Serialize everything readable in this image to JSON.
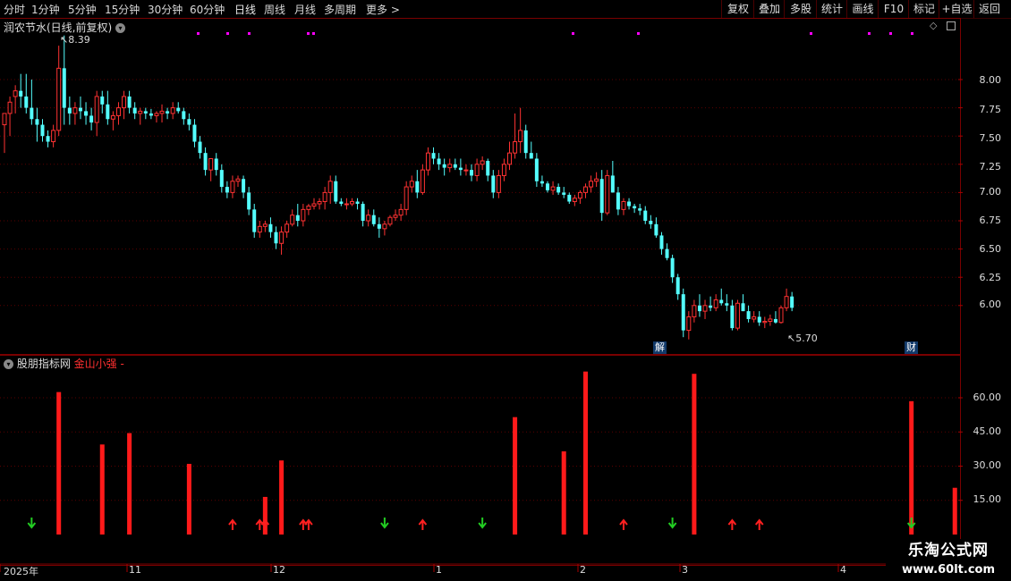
{
  "toolbar": {
    "periods": [
      "分时",
      "1分钟",
      "5分钟",
      "15分钟",
      "30分钟",
      "60分钟",
      "日线",
      "周线",
      "月线",
      "多周期",
      "更多"
    ],
    "more_arrow": ">",
    "right_buttons": [
      "复权",
      "叠加",
      "多股",
      "统计",
      "画线",
      "F10",
      "标记",
      "+自选",
      "返回"
    ]
  },
  "main_panel": {
    "title": "润农节水(日线,前复权)",
    "high_label": "8.39",
    "low_label": "5.70",
    "y_ticks": [
      "8.00",
      "7.75",
      "7.50",
      "7.25",
      "7.00",
      "6.75",
      "6.50",
      "6.25",
      "6.00"
    ],
    "markers": [
      "解",
      "财"
    ]
  },
  "indicator_panel": {
    "name": "股朋指标网",
    "indicator": "金山小强",
    "suffix": "-",
    "y_ticks": [
      "60.00",
      "45.00",
      "30.00",
      "15.00"
    ]
  },
  "x_axis": {
    "labels": [
      "2025年",
      "11",
      "12",
      "1",
      "2",
      "3",
      "4"
    ]
  },
  "watermark": {
    "line1": "乐淘公式网",
    "line2": "www.60lt.com"
  },
  "colors": {
    "up": "#ff3232",
    "down": "#54ffff",
    "bar": "#ff1a1a",
    "arrow_up": "#ff2020",
    "arrow_down": "#22cc22",
    "dots": "#ff00ff"
  },
  "chart_data": {
    "type": "candlestick",
    "price_axis": [
      5.7,
      8.39
    ],
    "candles": [
      [
        7.6,
        7.7,
        7.35,
        7.7
      ],
      [
        7.7,
        7.85,
        7.5,
        7.8
      ],
      [
        7.85,
        7.95,
        7.7,
        7.9
      ],
      [
        7.9,
        8.05,
        7.75,
        7.85
      ],
      [
        7.85,
        8.05,
        7.7,
        7.75
      ],
      [
        7.75,
        8.0,
        7.6,
        7.65
      ],
      [
        7.65,
        7.75,
        7.45,
        7.6
      ],
      [
        7.6,
        7.65,
        7.45,
        7.5
      ],
      [
        7.5,
        7.55,
        7.4,
        7.45
      ],
      [
        7.45,
        7.6,
        7.4,
        7.55
      ],
      [
        7.55,
        8.3,
        7.5,
        8.1
      ],
      [
        8.1,
        8.39,
        7.6,
        7.75
      ],
      [
        7.75,
        7.85,
        7.6,
        7.7
      ],
      [
        7.7,
        7.8,
        7.6,
        7.75
      ],
      [
        7.75,
        7.85,
        7.65,
        7.72
      ],
      [
        7.72,
        7.8,
        7.6,
        7.68
      ],
      [
        7.68,
        7.75,
        7.55,
        7.62
      ],
      [
        7.62,
        7.9,
        7.5,
        7.85
      ],
      [
        7.85,
        7.9,
        7.7,
        7.78
      ],
      [
        7.78,
        7.9,
        7.6,
        7.65
      ],
      [
        7.65,
        7.72,
        7.55,
        7.68
      ],
      [
        7.68,
        7.8,
        7.6,
        7.75
      ],
      [
        7.75,
        7.9,
        7.65,
        7.85
      ],
      [
        7.85,
        7.9,
        7.7,
        7.75
      ],
      [
        7.75,
        7.8,
        7.65,
        7.7
      ],
      [
        7.7,
        7.75,
        7.6,
        7.72
      ],
      [
        7.72,
        7.75,
        7.65,
        7.7
      ],
      [
        7.7,
        7.74,
        7.65,
        7.68
      ],
      [
        7.68,
        7.72,
        7.62,
        7.7
      ],
      [
        7.7,
        7.78,
        7.62,
        7.72
      ],
      [
        7.72,
        7.75,
        7.65,
        7.7
      ],
      [
        7.7,
        7.8,
        7.65,
        7.75
      ],
      [
        7.75,
        7.8,
        7.7,
        7.72
      ],
      [
        7.72,
        7.75,
        7.6,
        7.65
      ],
      [
        7.65,
        7.7,
        7.55,
        7.6
      ],
      [
        7.6,
        7.65,
        7.4,
        7.45
      ],
      [
        7.45,
        7.5,
        7.3,
        7.35
      ],
      [
        7.35,
        7.4,
        7.15,
        7.2
      ],
      [
        7.2,
        7.3,
        7.1,
        7.3
      ],
      [
        7.3,
        7.35,
        7.15,
        7.2
      ],
      [
        7.2,
        7.25,
        7.0,
        7.05
      ],
      [
        7.05,
        7.1,
        6.95,
        7.0
      ],
      [
        7.0,
        7.15,
        6.95,
        7.1
      ],
      [
        7.1,
        7.15,
        7.05,
        7.12
      ],
      [
        7.12,
        7.15,
        6.95,
        7.0
      ],
      [
        7.0,
        7.05,
        6.8,
        6.85
      ],
      [
        6.85,
        6.9,
        6.6,
        6.65
      ],
      [
        6.65,
        6.75,
        6.6,
        6.7
      ],
      [
        6.7,
        6.75,
        6.65,
        6.72
      ],
      [
        6.72,
        6.78,
        6.6,
        6.65
      ],
      [
        6.65,
        6.7,
        6.5,
        6.55
      ],
      [
        6.55,
        6.7,
        6.45,
        6.65
      ],
      [
        6.65,
        6.75,
        6.6,
        6.72
      ],
      [
        6.72,
        6.85,
        6.7,
        6.8
      ],
      [
        6.8,
        6.9,
        6.7,
        6.75
      ],
      [
        6.75,
        6.9,
        6.7,
        6.85
      ],
      [
        6.85,
        6.9,
        6.8,
        6.88
      ],
      [
        6.88,
        6.95,
        6.85,
        6.9
      ],
      [
        6.9,
        6.95,
        6.85,
        6.92
      ],
      [
        6.92,
        7.05,
        6.85,
        7.0
      ],
      [
        7.0,
        7.15,
        6.9,
        7.1
      ],
      [
        7.1,
        7.15,
        6.9,
        6.92
      ],
      [
        6.92,
        6.95,
        6.88,
        6.9
      ],
      [
        6.9,
        6.95,
        6.85,
        6.9
      ],
      [
        6.9,
        6.95,
        6.88,
        6.92
      ],
      [
        6.92,
        6.95,
        6.85,
        6.9
      ],
      [
        6.9,
        6.92,
        6.7,
        6.75
      ],
      [
        6.75,
        6.85,
        6.7,
        6.8
      ],
      [
        6.8,
        6.85,
        6.7,
        6.72
      ],
      [
        6.72,
        6.78,
        6.6,
        6.68
      ],
      [
        6.68,
        6.75,
        6.62,
        6.72
      ],
      [
        6.72,
        6.8,
        6.7,
        6.78
      ],
      [
        6.78,
        6.85,
        6.75,
        6.8
      ],
      [
        6.8,
        6.9,
        6.75,
        6.85
      ],
      [
        6.85,
        7.1,
        6.8,
        7.05
      ],
      [
        7.05,
        7.15,
        7.0,
        7.1
      ],
      [
        7.1,
        7.2,
        6.95,
        7.0
      ],
      [
        7.0,
        7.25,
        6.98,
        7.2
      ],
      [
        7.2,
        7.4,
        7.15,
        7.35
      ],
      [
        7.35,
        7.4,
        7.25,
        7.3
      ],
      [
        7.3,
        7.35,
        7.2,
        7.25
      ],
      [
        7.25,
        7.3,
        7.15,
        7.22
      ],
      [
        7.22,
        7.3,
        7.18,
        7.25
      ],
      [
        7.25,
        7.3,
        7.2,
        7.22
      ],
      [
        7.22,
        7.3,
        7.15,
        7.2
      ],
      [
        7.2,
        7.25,
        7.15,
        7.2
      ],
      [
        7.2,
        7.25,
        7.1,
        7.15
      ],
      [
        7.15,
        7.3,
        7.1,
        7.25
      ],
      [
        7.25,
        7.32,
        7.2,
        7.28
      ],
      [
        7.28,
        7.3,
        7.1,
        7.15
      ],
      [
        7.15,
        7.2,
        6.95,
        7.0
      ],
      [
        7.0,
        7.2,
        6.95,
        7.15
      ],
      [
        7.15,
        7.3,
        7.1,
        7.25
      ],
      [
        7.25,
        7.45,
        7.2,
        7.35
      ],
      [
        7.35,
        7.7,
        7.3,
        7.45
      ],
      [
        7.45,
        7.75,
        7.35,
        7.55
      ],
      [
        7.55,
        7.6,
        7.3,
        7.35
      ],
      [
        7.35,
        7.45,
        7.3,
        7.3
      ],
      [
        7.3,
        7.35,
        7.05,
        7.1
      ],
      [
        7.1,
        7.15,
        7.05,
        7.08
      ],
      [
        7.08,
        7.1,
        7.0,
        7.02
      ],
      [
        7.02,
        7.1,
        6.98,
        7.05
      ],
      [
        7.05,
        7.08,
        6.98,
        7.0
      ],
      [
        7.0,
        7.05,
        6.95,
        6.98
      ],
      [
        6.98,
        7.0,
        6.9,
        6.92
      ],
      [
        6.92,
        6.98,
        6.88,
        6.95
      ],
      [
        6.95,
        7.02,
        6.9,
        7.0
      ],
      [
        7.0,
        7.08,
        6.95,
        7.05
      ],
      [
        7.05,
        7.15,
        7.0,
        7.1
      ],
      [
        7.1,
        7.18,
        7.05,
        7.12
      ],
      [
        7.12,
        7.2,
        6.75,
        6.82
      ],
      [
        6.82,
        7.2,
        6.8,
        7.15
      ],
      [
        7.15,
        7.28,
        7.0,
        7.0
      ],
      [
        7.0,
        7.05,
        6.8,
        6.85
      ],
      [
        6.85,
        6.95,
        6.8,
        6.92
      ],
      [
        6.92,
        6.95,
        6.85,
        6.88
      ],
      [
        6.88,
        6.9,
        6.82,
        6.86
      ],
      [
        6.86,
        6.9,
        6.8,
        6.84
      ],
      [
        6.84,
        6.88,
        6.72,
        6.75
      ],
      [
        6.75,
        6.8,
        6.68,
        6.72
      ],
      [
        6.72,
        6.78,
        6.6,
        6.62
      ],
      [
        6.62,
        6.65,
        6.45,
        6.5
      ],
      [
        6.5,
        6.55,
        6.4,
        6.42
      ],
      [
        6.42,
        6.45,
        6.2,
        6.25
      ],
      [
        6.25,
        6.28,
        6.05,
        6.1
      ],
      [
        6.1,
        6.15,
        5.72,
        5.78
      ],
      [
        5.78,
        5.95,
        5.7,
        5.9
      ],
      [
        5.9,
        6.05,
        5.85,
        6.0
      ],
      [
        6.0,
        6.1,
        5.9,
        5.95
      ],
      [
        5.95,
        6.05,
        5.88,
        6.0
      ],
      [
        6.0,
        6.08,
        5.95,
        5.98
      ],
      [
        5.98,
        6.1,
        5.95,
        6.05
      ],
      [
        6.05,
        6.15,
        6.0,
        6.02
      ],
      [
        6.02,
        6.1,
        5.95,
        6.0
      ],
      [
        6.0,
        6.05,
        5.78,
        5.8
      ],
      [
        5.8,
        6.05,
        5.78,
        6.02
      ],
      [
        6.02,
        6.1,
        5.95,
        5.95
      ],
      [
        5.95,
        6.0,
        5.85,
        5.88
      ],
      [
        5.88,
        5.95,
        5.85,
        5.9
      ],
      [
        5.9,
        5.95,
        5.82,
        5.85
      ],
      [
        5.85,
        5.9,
        5.8,
        5.86
      ],
      [
        5.86,
        5.92,
        5.82,
        5.88
      ],
      [
        5.88,
        5.95,
        5.84,
        5.85
      ],
      [
        5.85,
        6.0,
        5.84,
        5.98
      ],
      [
        5.98,
        6.15,
        5.95,
        6.08
      ],
      [
        6.08,
        6.12,
        5.95,
        5.98
      ]
    ],
    "indicator_bars": [
      {
        "i": 10,
        "v": 62.5
      },
      {
        "i": 18,
        "v": 39.5
      },
      {
        "i": 23,
        "v": 44.5
      },
      {
        "i": 34,
        "v": 31.0
      },
      {
        "i": 48,
        "v": 16.5
      },
      {
        "i": 51,
        "v": 32.5
      },
      {
        "i": 94,
        "v": 51.5
      },
      {
        "i": 103,
        "v": 36.5
      },
      {
        "i": 107,
        "v": 71.5
      },
      {
        "i": 127,
        "v": 70.5
      },
      {
        "i": 167,
        "v": 58.5
      },
      {
        "i": 175,
        "v": 20.5
      }
    ],
    "signals_up": [
      42,
      47,
      48,
      55,
      56,
      77,
      114,
      134,
      139
    ],
    "signals_down": [
      5,
      70,
      88,
      123,
      167
    ]
  }
}
